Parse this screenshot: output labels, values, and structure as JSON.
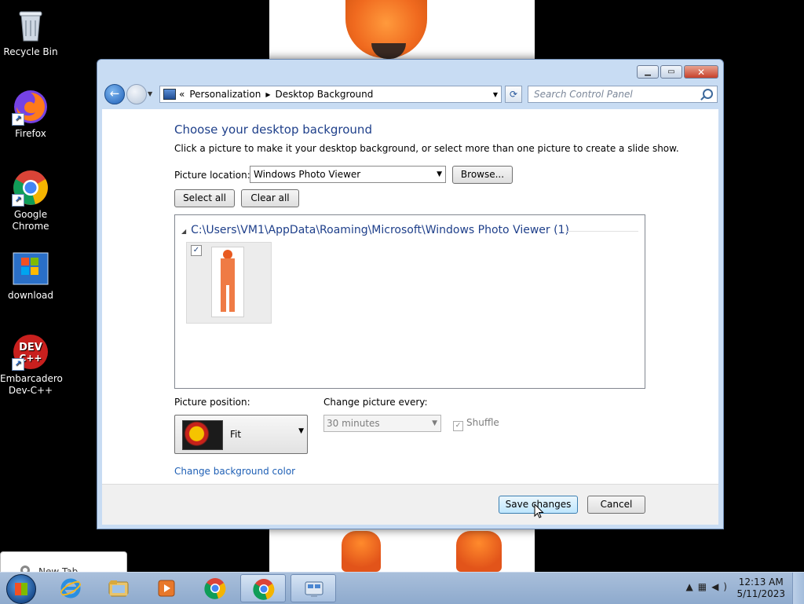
{
  "desktop": {
    "icons": [
      {
        "label": "Recycle Bin"
      },
      {
        "label": "Firefox"
      },
      {
        "label": "Google Chrome"
      },
      {
        "label": "download"
      },
      {
        "label": "Embarcadero Dev-C++"
      }
    ],
    "preview_tab": "New Tab"
  },
  "window": {
    "breadcrumb": {
      "prefix": "«",
      "items": [
        "Personalization",
        "Desktop Background"
      ]
    },
    "search_placeholder": "Search Control Panel",
    "heading": "Choose your desktop background",
    "subheading": "Click a picture to make it your desktop background, or select more than one picture to create a slide show.",
    "picture_location": {
      "label": "Picture location:",
      "value": "Windows Photo Viewer"
    },
    "browse_label": "Browse...",
    "select_all_label": "Select all",
    "clear_all_label": "Clear all",
    "gallery": {
      "group_title": "C:\\Users\\VM1\\AppData\\Roaming\\Microsoft\\Windows Photo Viewer (1)",
      "items": [
        {
          "checked": true
        }
      ]
    },
    "picture_position": {
      "label": "Picture position:",
      "value": "Fit"
    },
    "change_picture": {
      "label": "Change picture every:",
      "value": "30 minutes"
    },
    "shuffle": {
      "label": "Shuffle",
      "checked": true,
      "enabled": false
    },
    "change_color_link": "Change background color",
    "save_label": "Save changes",
    "cancel_label": "Cancel"
  },
  "taskbar": {
    "time": "12:13 AM",
    "date": "5/11/2023",
    "pinned": [
      "start-orb",
      "internet-explorer-icon",
      "file-explorer-icon",
      "media-player-icon",
      "chrome-icon",
      "chrome-icon",
      "control-panel-icon"
    ]
  },
  "colors": {
    "heading": "#1e3f8a",
    "link": "#1e5fb5",
    "window_frame": "#c8dcf3"
  }
}
